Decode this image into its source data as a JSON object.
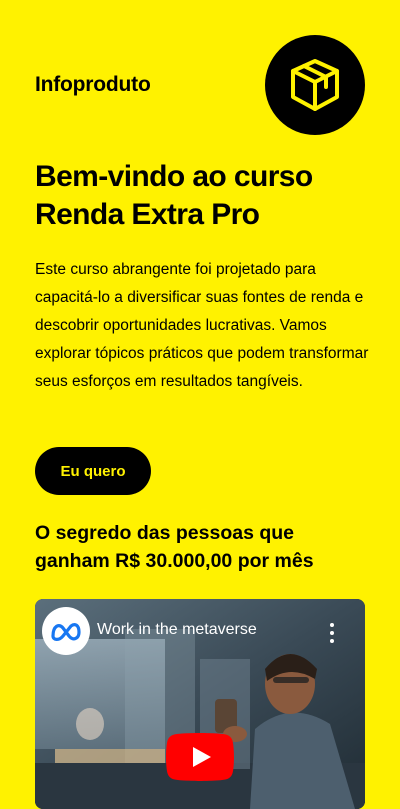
{
  "header": {
    "brand": "Infoproduto",
    "logo_icon": "box-icon",
    "accent": "#FFF200"
  },
  "hero": {
    "title_line1": "Bem-vindo ao curso",
    "title_line2": "Renda Extra Pro",
    "description": "Este curso abrangente foi projetado para capacitá-lo a diversificar suas fontes de renda e descobrir oportunidades lucrativas. Vamos explorar tópicos práticos que podem transformar seus esforços em resultados tangíveis.",
    "cta_label": "Eu quero"
  },
  "section": {
    "heading_line1": "O segredo das pessoas que",
    "heading_line2": "ganham R$ 30.000,00 por mês"
  },
  "video": {
    "title": "Work in the metaverse",
    "channel_icon": "meta-logo-icon",
    "play_color": "#FF0000"
  }
}
